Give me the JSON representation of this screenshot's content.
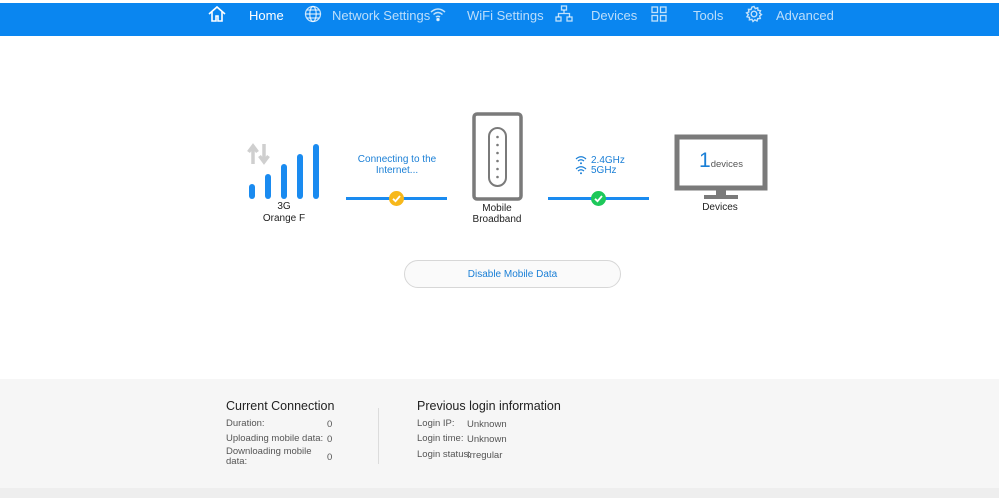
{
  "nav": {
    "items": [
      {
        "label": "Home",
        "icon": "home-icon"
      },
      {
        "label": "Network Settings",
        "icon": "globe-icon"
      },
      {
        "label": "WiFi Settings",
        "icon": "wifi-icon"
      },
      {
        "label": "Devices",
        "icon": "network-topology-icon"
      },
      {
        "label": "Tools",
        "icon": "grid-tools-icon"
      },
      {
        "label": "Advanced",
        "icon": "gear-icon"
      }
    ],
    "active": "Home",
    "colors": {
      "bar": "#0a86f0",
      "active_text": "#ffffff"
    }
  },
  "status": {
    "network_type": "3G",
    "operator": "Orange F",
    "connection_text": "Connecting to the Internet...",
    "device_label": "Mobile Broadband",
    "wifi_bands": [
      "2.4GHz",
      "5GHz"
    ],
    "devices_count": "1",
    "devices_unit": "devices",
    "devices_label": "Devices",
    "signal_bars_active": 5,
    "colors": {
      "line": "#1a8bf0",
      "warning": "#f7b81b",
      "ok": "#1ec85a"
    }
  },
  "actions": {
    "disable_mobile_data": "Disable Mobile Data"
  },
  "current_connection": {
    "title": "Current Connection",
    "rows": [
      {
        "label": "Duration:",
        "value": "0"
      },
      {
        "label": "Uploading mobile data:",
        "value": "0"
      },
      {
        "label": "Downloading mobile data:",
        "value": "0"
      }
    ]
  },
  "previous_login": {
    "title": "Previous login information",
    "rows": [
      {
        "label": "Login IP:",
        "value": "Unknown"
      },
      {
        "label": "Login time:",
        "value": "Unknown"
      },
      {
        "label": "Login status:",
        "value": "Irregular"
      }
    ]
  }
}
